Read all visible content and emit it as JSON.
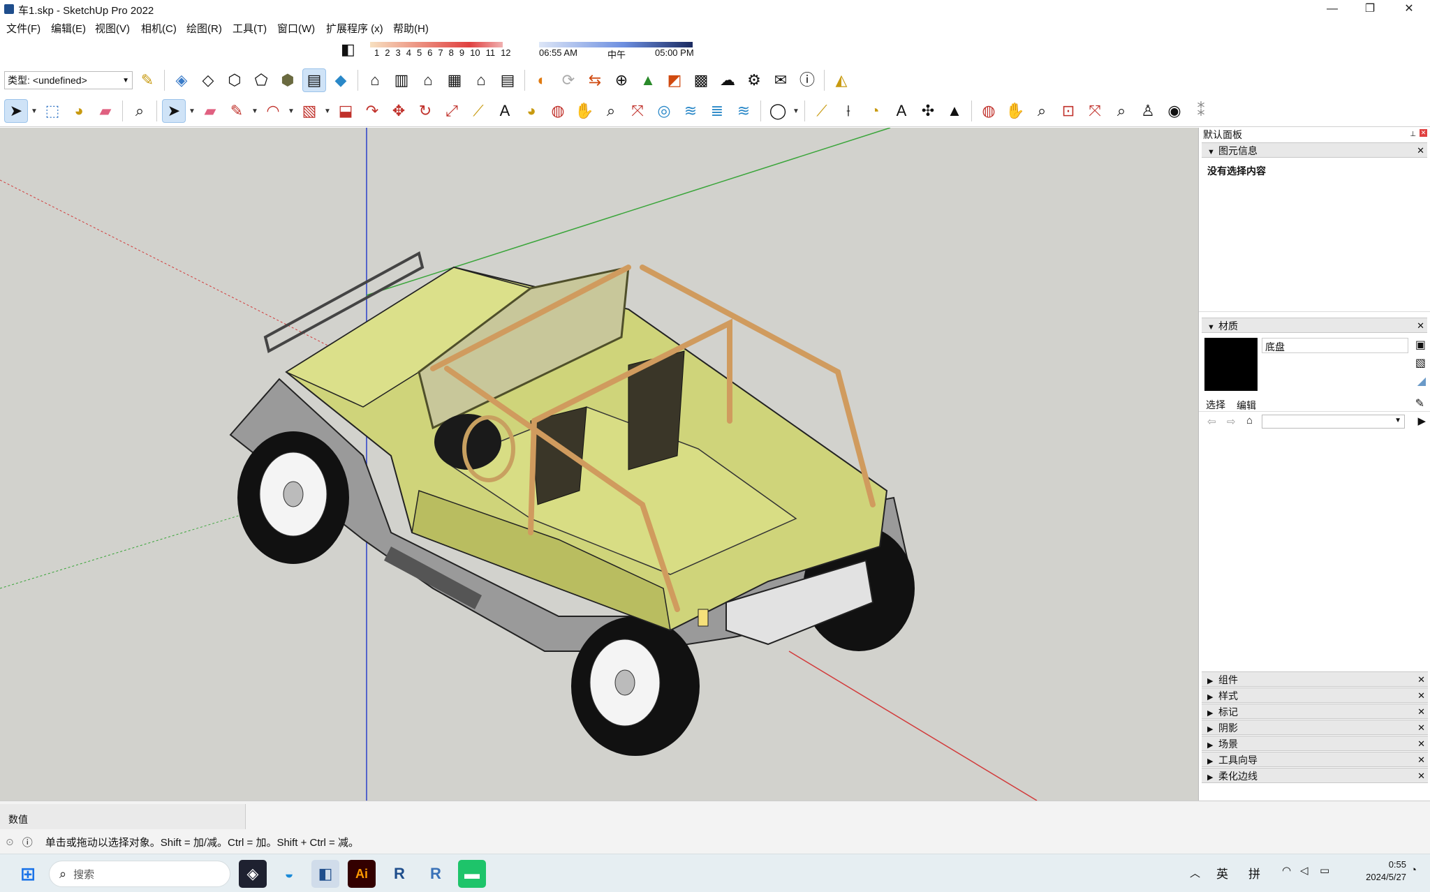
{
  "window": {
    "title": "车1.skp - SketchUp Pro 2022",
    "minimize_glyph": "—",
    "maximize_glyph": "❐",
    "close_glyph": "✕"
  },
  "menu": [
    "文件(F)",
    "编辑(E)",
    "视图(V)",
    "相机(C)",
    "绘图(R)",
    "工具(T)",
    "窗口(W)",
    "扩展程序 (x)",
    "帮助(H)"
  ],
  "shadow": {
    "months": [
      "1",
      "2",
      "3",
      "4",
      "5",
      "6",
      "7",
      "8",
      "9",
      "10",
      "11",
      "12"
    ],
    "time_start": "06:55 AM",
    "time_mid": "中午",
    "time_end": "05:00 PM"
  },
  "tag": {
    "label": "类型:",
    "value": "<undefined>"
  },
  "viewport": {
    "background": "#d2d2cd",
    "axis_red": "#d23b3b",
    "axis_green": "#3aa53a",
    "axis_blue": "#2a3fc9",
    "body_color": "#cfd47a",
    "rollbar_color": "#d09b5e"
  },
  "panel": {
    "title": "默认面板",
    "entity_info": {
      "header": "图元信息",
      "content": "没有选择内容"
    },
    "materials": {
      "header": "材质",
      "name": "底盘",
      "swatch": "#000000",
      "tab_select": "选择",
      "tab_edit": "编辑"
    },
    "collapsed": [
      "组件",
      "样式",
      "标记",
      "阴影",
      "场景",
      "工具向导",
      "柔化边线"
    ]
  },
  "status": {
    "measurements_label": "数值",
    "hint": "单击或拖动以选择对象。Shift = 加/减。Ctrl = 加。Shift + Ctrl = 减。"
  },
  "taskbar": {
    "search_placeholder": "搜索",
    "lang": "英",
    "ime": "拼",
    "time": "0:55",
    "date": "2024/5/27"
  }
}
